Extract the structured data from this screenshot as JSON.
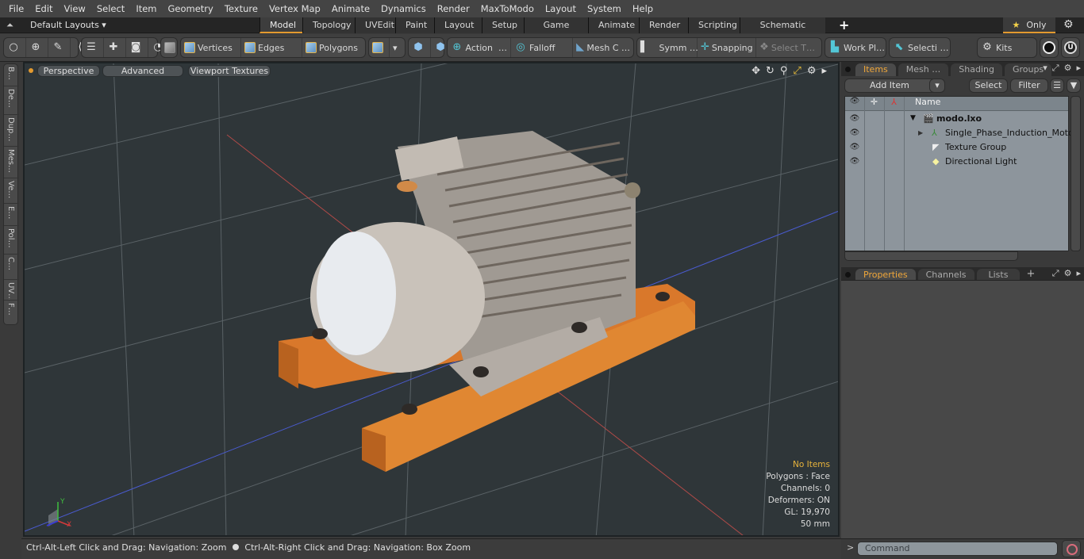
{
  "menu": [
    "File",
    "Edit",
    "View",
    "Select",
    "Item",
    "Geometry",
    "Texture",
    "Vertex Map",
    "Animate",
    "Dynamics",
    "Render",
    "MaxToModo",
    "Layout",
    "System",
    "Help"
  ],
  "layoutbar": {
    "layouts_label": "Default Layouts ▾",
    "tabs": [
      "Model",
      "Topology",
      "UVEdit",
      "Paint",
      "Layout",
      "Setup",
      "Game Tools",
      "Animate",
      "Render",
      "Scripting",
      "Schematic Fusion"
    ],
    "active_tab": "Model",
    "add_tab": "+",
    "only_label": "Only"
  },
  "toolbar": {
    "vertices": "Vertices",
    "edges": "Edges",
    "polygons": "Polygons",
    "action": "Action",
    "action_more": "…",
    "falloff": "Falloff",
    "mesh": "Mesh C …",
    "symm": "Symm …",
    "snapping": "Snapping",
    "select_t": "Select T…",
    "work_pl": "Work Pl…",
    "selecti": "Selecti …",
    "kits": "Kits"
  },
  "left_tabs": [
    "B…",
    "De…",
    "Dup…",
    "Mes…",
    "Ve…",
    "E…",
    "Pol…",
    "C…",
    "UV…",
    "F…"
  ],
  "viewport": {
    "perspective": "Perspective",
    "advanced": "Advanced",
    "viewport_textures": "Viewport Textures",
    "stats": {
      "no_items": "No Items",
      "polygons": "Polygons : Face",
      "channels": "Channels: 0",
      "deformers": "Deformers: ON",
      "gl": "GL: 19,970",
      "scale": "50 mm"
    },
    "axis": {
      "x": "X",
      "y": "Y"
    }
  },
  "items_panel": {
    "tabs": [
      "Items",
      "Mesh …",
      "Shading",
      "Groups"
    ],
    "active_tab": "Items",
    "add_item": "Add Item",
    "select": "Select",
    "filter": "Filter",
    "column_name": "Name",
    "rows": [
      {
        "name": "modo.lxo",
        "bold": true
      },
      {
        "name": "Single_Phase_Induction_Motor",
        "bold": false
      },
      {
        "name": "Texture Group",
        "bold": false
      },
      {
        "name": "Directional Light",
        "bold": false
      }
    ]
  },
  "props_panel": {
    "tabs": [
      "Properties",
      "Channels",
      "Lists"
    ],
    "active_tab": "Properties",
    "add_tab": "+"
  },
  "statusbar": {
    "left": "Ctrl-Alt-Left Click and Drag: Navigation: Zoom",
    "right": "Ctrl-Alt-Right Click and Drag: Navigation: Box Zoom"
  },
  "command": {
    "placeholder": "Command",
    "prompt": ">"
  },
  "colors": {
    "accent": "#e39a2f",
    "rail": "#d9782b",
    "motor": "#c9c2ba",
    "grid_bg": "#2f3639"
  }
}
